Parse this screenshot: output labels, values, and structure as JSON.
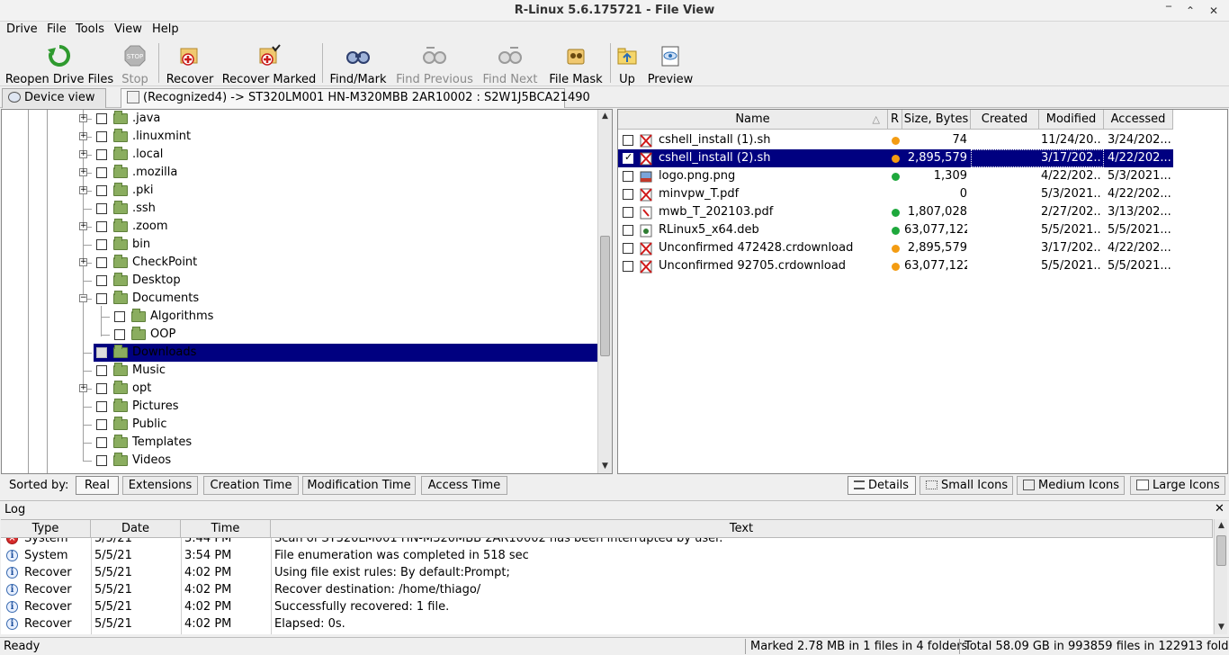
{
  "window": {
    "title": "R-Linux 5.6.175721 - File View"
  },
  "menu": [
    "Drive",
    "File",
    "Tools",
    "View",
    "Help"
  ],
  "toolbar": {
    "reopen": "Reopen Drive Files",
    "stop": "Stop",
    "recover": "Recover",
    "recover_marked": "Recover Marked",
    "find_mark": "Find/Mark",
    "find_previous": "Find Previous",
    "find_next": "Find Next",
    "file_mask": "File Mask",
    "up": "Up",
    "preview": "Preview"
  },
  "tabs": {
    "device_view": "Device view",
    "file_view": "(Recognized4) -> ST320LM001 HN-M320MBB 2AR10002 : S2W1J5BCA21490"
  },
  "tree": {
    "items": [
      {
        "name": ".java"
      },
      {
        "name": ".linuxmint"
      },
      {
        "name": ".local"
      },
      {
        "name": ".mozilla"
      },
      {
        "name": ".pki"
      },
      {
        "name": ".ssh"
      },
      {
        "name": ".zoom"
      },
      {
        "name": "bin"
      },
      {
        "name": "CheckPoint"
      },
      {
        "name": "Desktop"
      },
      {
        "name": "Documents"
      },
      {
        "name": "Algorithms"
      },
      {
        "name": "OOP"
      },
      {
        "name": "Downloads"
      },
      {
        "name": "Music"
      },
      {
        "name": "opt"
      },
      {
        "name": "Pictures"
      },
      {
        "name": "Public"
      },
      {
        "name": "Templates"
      },
      {
        "name": "Videos"
      }
    ]
  },
  "files": {
    "headers": [
      "Name",
      "R",
      "Size, Bytes",
      "Created",
      "Modified",
      "Accessed"
    ],
    "rows": [
      {
        "name": "cshell_install (1).sh",
        "status": "orange",
        "size": "74",
        "created": "",
        "modified": "11/24/20...",
        "accessed": "3/24/202..."
      },
      {
        "name": "cshell_install (2).sh",
        "status": "orange",
        "size": "2,895,579",
        "created": "",
        "modified": "3/17/202...",
        "accessed": "4/22/202..."
      },
      {
        "name": "logo.png.png",
        "status": "green",
        "size": "1,309",
        "created": "",
        "modified": "4/22/202...",
        "accessed": "5/3/2021..."
      },
      {
        "name": "minvpw_T.pdf",
        "status": "",
        "size": "0",
        "created": "",
        "modified": "5/3/2021...",
        "accessed": "4/22/202..."
      },
      {
        "name": "mwb_T_202103.pdf",
        "status": "green",
        "size": "1,807,028",
        "created": "",
        "modified": "2/27/202...",
        "accessed": "3/13/202..."
      },
      {
        "name": "RLinux5_x64.deb",
        "status": "green",
        "size": "63,077,122",
        "created": "",
        "modified": "5/5/2021...",
        "accessed": "5/5/2021..."
      },
      {
        "name": "Unconfirmed 472428.crdownload",
        "status": "orange",
        "size": "2,895,579",
        "created": "",
        "modified": "3/17/202...",
        "accessed": "4/22/202..."
      },
      {
        "name": "Unconfirmed 92705.crdownload",
        "status": "orange",
        "size": "63,077,122",
        "created": "",
        "modified": "5/5/2021...",
        "accessed": "5/5/2021..."
      }
    ]
  },
  "sort": {
    "label": "Sorted by:",
    "options": [
      "Real",
      "Extensions",
      "Creation Time",
      "Modification Time",
      "Access Time"
    ]
  },
  "views": [
    "Details",
    "Small Icons",
    "Medium Icons",
    "Large Icons"
  ],
  "log": {
    "title": "Log",
    "headers": [
      "Type",
      "Date",
      "Time",
      "Text"
    ],
    "rows": [
      {
        "type": "System",
        "date": "5/5/21",
        "time": "3:44 PM",
        "text": "Scan of ST320LM001 HN-M320MBB 2AR10002 has been interrupted by user."
      },
      {
        "type": "System",
        "date": "5/5/21",
        "time": "3:54 PM",
        "text": "File enumeration was completed in 518 sec"
      },
      {
        "type": "Recover",
        "date": "5/5/21",
        "time": "4:02 PM",
        "text": "Using file exist rules: By default:Prompt;"
      },
      {
        "type": "Recover",
        "date": "5/5/21",
        "time": "4:02 PM",
        "text": "Recover destination: /home/thiago/"
      },
      {
        "type": "Recover",
        "date": "5/5/21",
        "time": "4:02 PM",
        "text": "Successfully recovered: 1 file."
      },
      {
        "type": "Recover",
        "date": "5/5/21",
        "time": "4:02 PM",
        "text": "Elapsed: 0s."
      }
    ]
  },
  "status": {
    "ready": "Ready",
    "marked": "Marked 2.78 MB in 1 files in 4 folders",
    "total": "Total 58.09 GB in 993859 files in 122913 folders"
  },
  "colors": {
    "selection": "#000080",
    "folder": "#8aad5f",
    "status_orange": "#f39c12",
    "status_green": "#1ea83c"
  }
}
